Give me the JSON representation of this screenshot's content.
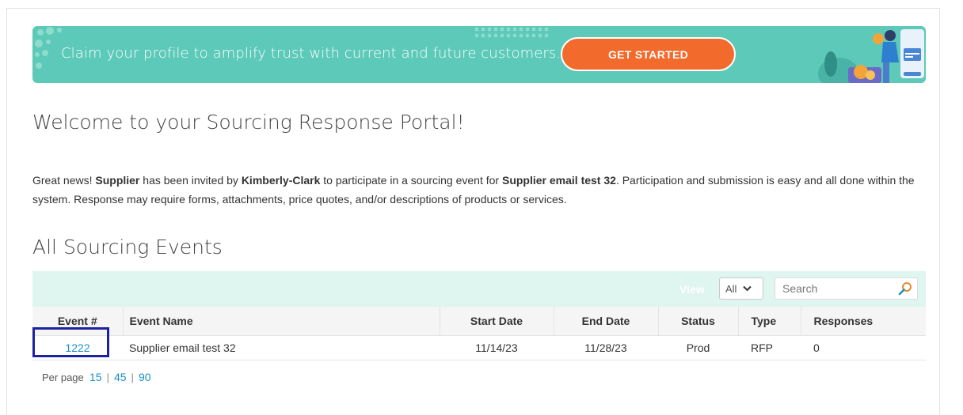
{
  "banner": {
    "message": "Claim your profile to amplify trust with current and future customers.",
    "button_label": "GET STARTED",
    "accent_color": "#5cc9b9",
    "button_color": "#f26a2c"
  },
  "page": {
    "title": "Welcome to your Sourcing Response Portal!"
  },
  "intro": {
    "part1": "Great news! ",
    "supplier": "Supplier",
    "part2": " has been invited by ",
    "buyer": "Kimberly-Clark",
    "part3": " to participate in a sourcing event for ",
    "event": "Supplier email test 32",
    "part4": ". Participation and submission is easy and all done within the system. Response may require forms, attachments, price quotes, and/or descriptions of products or services."
  },
  "events_section": {
    "title": "All Sourcing Events",
    "view_label": "View",
    "view_value": "All",
    "search_placeholder": "Search"
  },
  "table": {
    "headers": {
      "event": "Event #",
      "name": "Event Name",
      "start": "Start Date",
      "end": "End Date",
      "status": "Status",
      "type": "Type",
      "responses": "Responses"
    },
    "rows": [
      {
        "event": "1222",
        "name": "Supplier email test 32",
        "start": "11/14/23",
        "end": "11/28/23",
        "status": "Prod",
        "type": "RFP",
        "responses": "0"
      }
    ]
  },
  "pagination": {
    "label": "Per page",
    "options": [
      "15",
      "45",
      "90"
    ],
    "separator": "|"
  }
}
